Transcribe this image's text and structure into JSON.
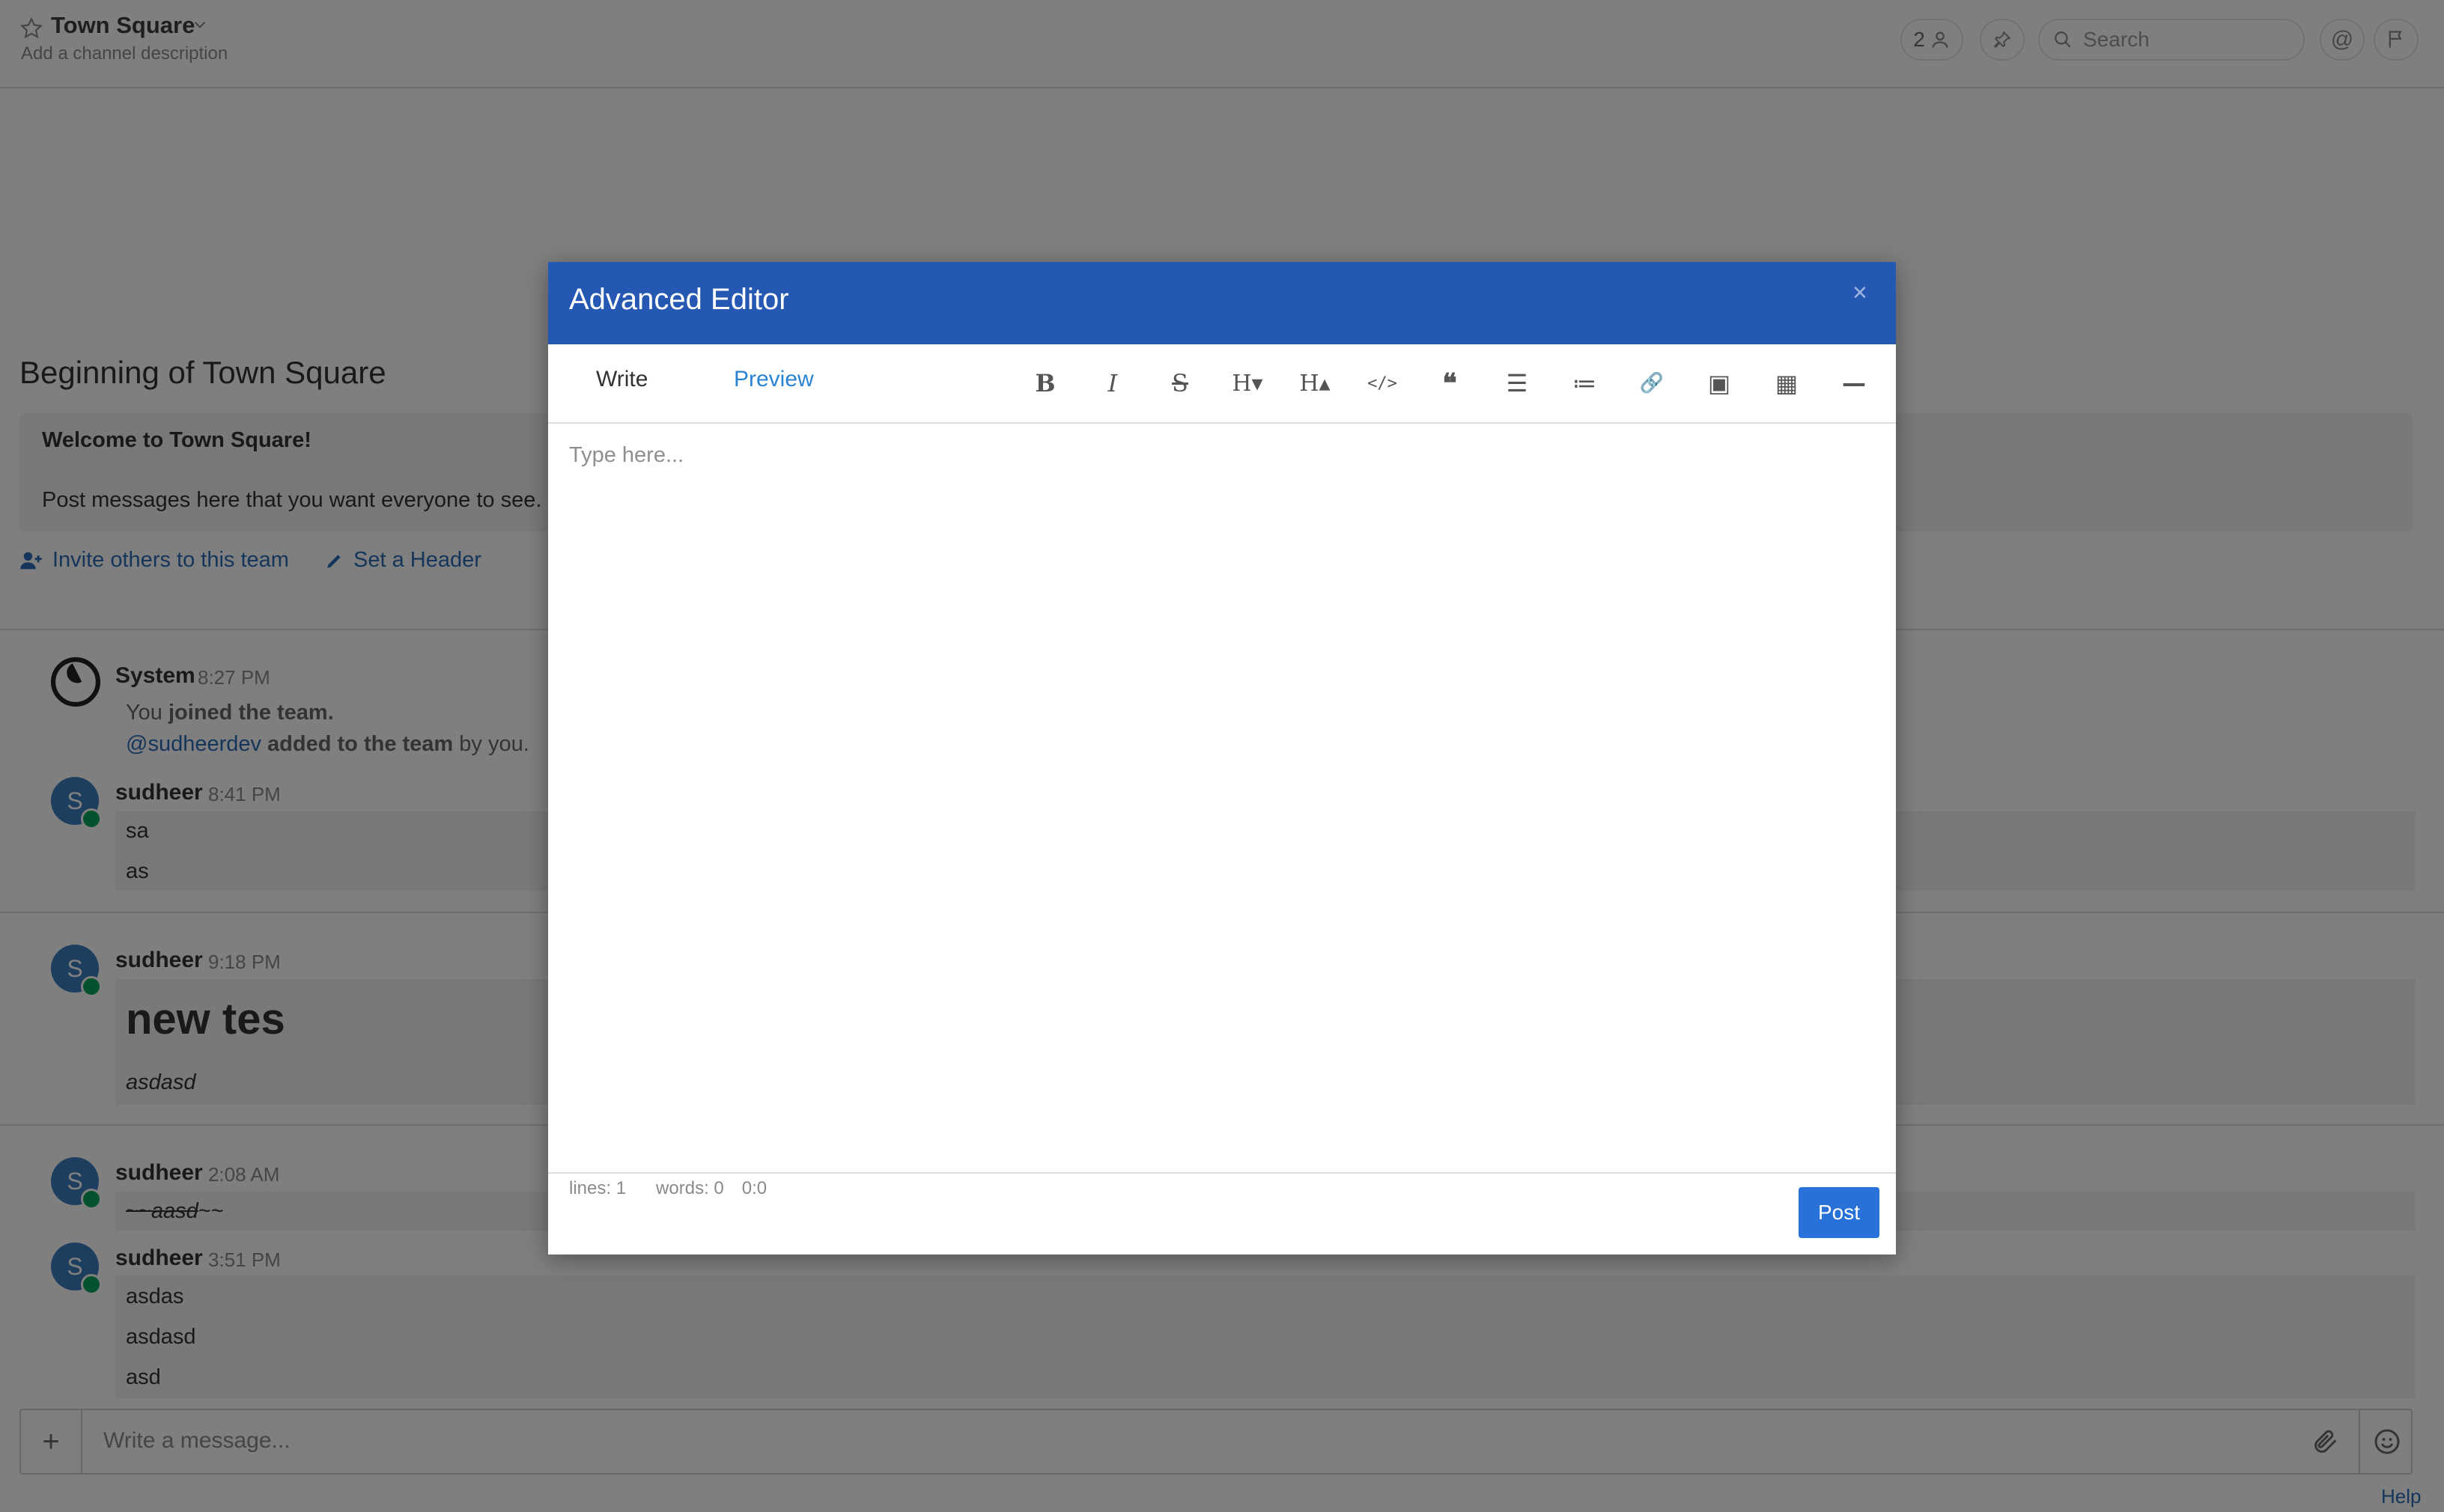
{
  "header": {
    "channel_name": "Town Square",
    "channel_description": "Add a channel description",
    "member_count": "2",
    "search_placeholder": "Search"
  },
  "intro": {
    "title": "Beginning of Town Square",
    "welcome_heading": "Welcome to Town Square!",
    "welcome_body": "Post messages here that you want everyone to see. Everyone automatically becomes a permanent member of this channel when they join the team.",
    "invite_link": "Invite others to this team",
    "set_header_link": "Set a Header"
  },
  "posts": [
    {
      "author": "System",
      "time": "8:27 PM",
      "line1_prefix": "You ",
      "line1_bold": "joined the team.",
      "line2_mention": "@sudheerdev",
      "line2_bold": " added to the team",
      "line2_suffix": " by you."
    },
    {
      "author": "sudheer",
      "avatar_letter": "S",
      "time": "8:41 PM",
      "lines": [
        "sa",
        "as"
      ]
    },
    {
      "author": "sudheer",
      "avatar_letter": "S",
      "time": "9:18 PM",
      "heading": "new tes",
      "italic": "asdasd"
    },
    {
      "author": "sudheer",
      "avatar_letter": "S",
      "time": "2:08 AM",
      "strike_prefix": "~~",
      "strike_text": "aasd",
      "strike_suffix": "~~"
    },
    {
      "author": "sudheer",
      "avatar_letter": "S",
      "time": "3:51 PM",
      "lines": [
        "asdas",
        "asdasd",
        "asd"
      ]
    }
  ],
  "composer": {
    "placeholder": "Write a message...",
    "plus_label": "+",
    "help_label": "Help"
  },
  "modal": {
    "title": "Advanced Editor",
    "close_label": "×",
    "tab_write": "Write",
    "tab_preview": "Preview",
    "toolbar": [
      {
        "name": "bold",
        "label": "B"
      },
      {
        "name": "italic",
        "label": "I"
      },
      {
        "name": "strikethrough",
        "label": "S"
      },
      {
        "name": "heading-smaller",
        "label": "H▾"
      },
      {
        "name": "heading-bigger",
        "label": "H▴"
      },
      {
        "name": "code",
        "label": "</>"
      },
      {
        "name": "quote",
        "label": "❝"
      },
      {
        "name": "unordered-list",
        "label": "☰"
      },
      {
        "name": "ordered-list",
        "label": "≔"
      },
      {
        "name": "link",
        "label": "🔗"
      },
      {
        "name": "image",
        "label": "▣"
      },
      {
        "name": "table",
        "label": "▦"
      },
      {
        "name": "horizontal-rule",
        "label": "—"
      }
    ],
    "editor_placeholder": "Type here...",
    "status_lines": "lines: 1",
    "status_words": "words: 0",
    "status_cursor": "0:0",
    "post_label": "Post"
  },
  "colors": {
    "modal_header": "#2458b2",
    "link": "#2a6cb5",
    "post_button": "#2771d8",
    "online_status": "#06a55e"
  }
}
